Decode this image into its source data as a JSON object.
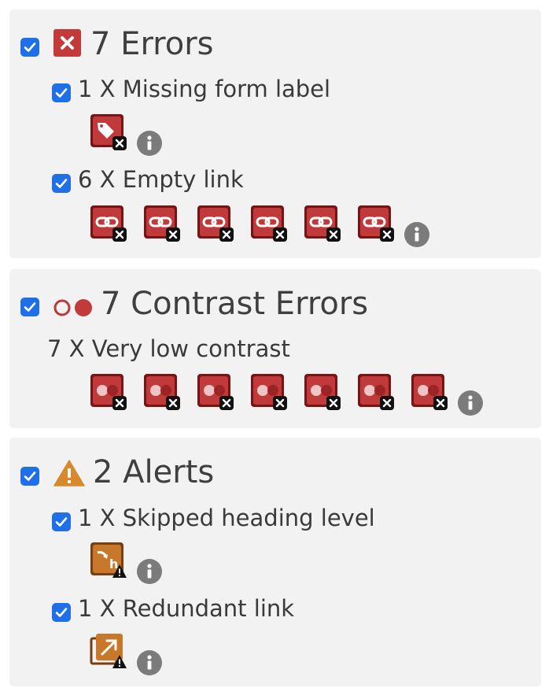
{
  "errors": {
    "heading": "7 Errors",
    "icon": "error-x-icon",
    "items": [
      {
        "label": "1 X Missing form label",
        "icon": "missing-label-icon",
        "count": 1
      },
      {
        "label": "6 X Empty link",
        "icon": "empty-link-icon",
        "count": 6
      }
    ]
  },
  "contrast": {
    "heading": "7 Contrast Errors",
    "icon": "contrast-icon",
    "items": [
      {
        "label": "7 X Very low contrast",
        "icon": "low-contrast-icon",
        "count": 7
      }
    ]
  },
  "alerts": {
    "heading": "2 Alerts",
    "icon": "alert-triangle-icon",
    "items": [
      {
        "label": "1 X Skipped heading level",
        "icon": "skipped-heading-icon",
        "count": 1
      },
      {
        "label": "1 X Redundant link",
        "icon": "redundant-link-icon",
        "count": 1
      }
    ]
  },
  "colors": {
    "error_red": "#c0393b",
    "error_dark": "#7a1414",
    "alert_orange": "#c8782a",
    "checkbox_blue": "#1f6fe8",
    "info_gray": "#7b7b7b",
    "panel_bg": "#f2f2f2"
  }
}
